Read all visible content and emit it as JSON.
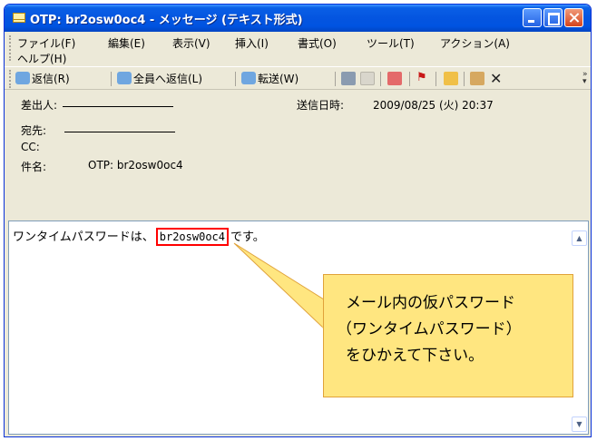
{
  "window": {
    "title": "OTP: br2osw0oc4 - メッセージ (テキスト形式)"
  },
  "menu": [
    "ファイル(F)",
    "編集(E)",
    "表示(V)",
    "挿入(I)",
    "書式(O)",
    "ツール(T)",
    "アクション(A)",
    "ヘルプ(H)"
  ],
  "toolbar": {
    "reply": "返信(R)",
    "reply_all": "全員へ返信(L)",
    "forward": "転送(W)"
  },
  "header": {
    "from_label": "差出人:",
    "to_label": "宛先:",
    "cc_label": "CC:",
    "subject_label": "件名:",
    "subject_value": "OTP: br2osw0oc4",
    "sent_label": "送信日時:",
    "sent_value": "2009/08/25 (火) 20:37"
  },
  "message": {
    "prefix": "ワンタイムパスワードは、",
    "password": "br2osw0oc4",
    "suffix": "です。"
  },
  "callout": {
    "lines": [
      "メール内の仮パスワード",
      "（ワンタイムパスワード）",
      "をひかえて下さい。"
    ]
  },
  "colors": {
    "highlight": "#ff0000",
    "callout_fill": "#ffe680",
    "titlebar": "#0455e0"
  }
}
